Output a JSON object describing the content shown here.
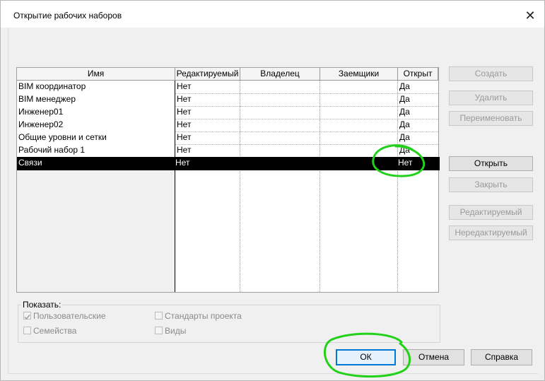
{
  "dialog": {
    "title": "Открытие рабочих наборов",
    "close_glyph": "✕"
  },
  "table": {
    "columns": [
      "Имя",
      "Редактируемый",
      "Владелец",
      "Заемщики",
      "Открыт"
    ],
    "rows": [
      {
        "name": "BIM координатор",
        "editable": "Нет",
        "owner": "",
        "borrowers": "",
        "open": "Да"
      },
      {
        "name": "BIM менеджер",
        "editable": "Нет",
        "owner": "",
        "borrowers": "",
        "open": "Да"
      },
      {
        "name": "Инженер01",
        "editable": "Нет",
        "owner": "",
        "borrowers": "",
        "open": "Да"
      },
      {
        "name": "Инженер02",
        "editable": "Нет",
        "owner": "",
        "borrowers": "",
        "open": "Да"
      },
      {
        "name": "Общие уровни и сетки",
        "editable": "Нет",
        "owner": "",
        "borrowers": "",
        "open": "Да"
      },
      {
        "name": "Рабочий набор 1",
        "editable": "Нет",
        "owner": "",
        "borrowers": "",
        "open": "Да"
      },
      {
        "name": "Связи",
        "editable": "Нет",
        "owner": "",
        "borrowers": "",
        "open": "Нет"
      }
    ],
    "selected_row_index": 6
  },
  "side_buttons": {
    "create": "Создать",
    "delete": "Удалить",
    "rename": "Переименовать",
    "open": "Открыть",
    "close": "Закрыть",
    "editable": "Редактируемый",
    "non_editable": "Нередактируемый"
  },
  "show_group": {
    "label": "Показать:",
    "user_defined": "Пользовательские",
    "families": "Семейства",
    "project_standards": "Стандарты проекта",
    "views": "Виды"
  },
  "footer": {
    "ok": "ОК",
    "cancel": "Отмена",
    "help": "Справка"
  },
  "colors": {
    "selection": "#000000",
    "default_button_border": "#0078d7",
    "annotation_green": "#22d11a"
  }
}
